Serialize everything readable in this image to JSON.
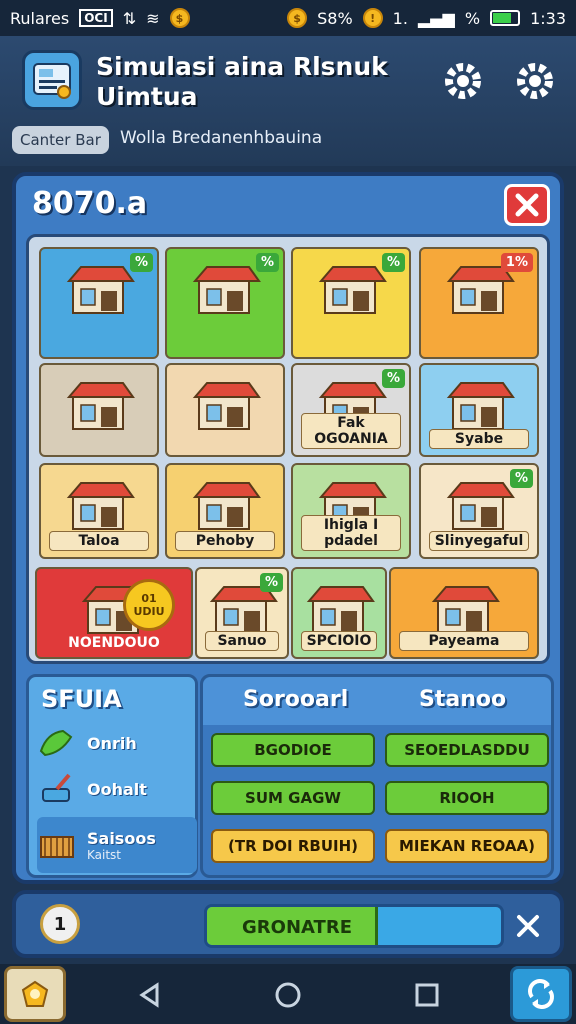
{
  "status_bar": {
    "carrier": "Rulares",
    "box_label": "OCI",
    "left_coin_glyph": "$",
    "percent_text": "S8%",
    "coin_glyph": "$",
    "signal_text": "1.",
    "signal_pct": "%",
    "time": "1:33",
    "battery_level": 0.7
  },
  "header": {
    "title_line1": "Simulasi aina Rlsnuk",
    "title_line2": "Uimtua",
    "chip_label": "Canter Bar",
    "subtitle": "Wolla Bredanenhbauina"
  },
  "panel": {
    "title": "8070.a",
    "tiles": [
      {
        "label": "",
        "badge": "%",
        "bg": "#4aa8e0",
        "icon": "shop-icon"
      },
      {
        "label": "",
        "badge": "%",
        "bg": "#6ccc3a",
        "icon": "store-icon"
      },
      {
        "label": "",
        "badge": "%",
        "bg": "#f6d84a",
        "icon": "kiosk-icon"
      },
      {
        "label": "",
        "badge": "1%",
        "bg": "#f6a83a",
        "icon": "market-stall-icon"
      },
      {
        "label": "",
        "badge": "",
        "bg": "#d8cdb8",
        "icon": "crates-icon"
      },
      {
        "label": "",
        "badge": "",
        "bg": "#f2d8b0",
        "icon": "storefront-icon"
      },
      {
        "label": "Fak OGOANIA",
        "badge": "%",
        "bg": "#dcdcdc",
        "icon": "machines-icon"
      },
      {
        "label": "Syabe",
        "badge": "",
        "bg": "#8ecff0",
        "icon": "warehouse-icon"
      },
      {
        "label": "Taloa",
        "badge": "",
        "bg": "#f6d890",
        "icon": "freezer-icon"
      },
      {
        "label": "Pehoby",
        "badge": "",
        "bg": "#f6d070",
        "icon": "register-icon"
      },
      {
        "label": "Ihigla I pdadel",
        "badge": "",
        "bg": "#b8e0a0",
        "icon": "cart-icon"
      },
      {
        "label": "Slinyegaful",
        "badge": "%",
        "bg": "#f6e6c8",
        "icon": "jars-icon"
      },
      {
        "label": "NOENDOUO",
        "badge": "",
        "bg": "#e03a3a",
        "icon": "basket-coin-icon",
        "coin_text": "01\nUDIU"
      },
      {
        "label": "Sanuo",
        "badge": "%",
        "bg": "#f6e6c0",
        "icon": "scanner-icon"
      },
      {
        "label": "SPCIOIO",
        "badge": "",
        "bg": "#a8e0a0",
        "icon": "magnifier-icon"
      },
      {
        "label": "Payeama",
        "badge": "",
        "bg": "#f6a83a",
        "icon": "cash-icon"
      }
    ]
  },
  "lower_left": {
    "title": "SFUIA",
    "items": [
      {
        "label": "Onrih",
        "icon": "scoop-icon"
      },
      {
        "label": "Oohalt",
        "icon": "knife-icon"
      },
      {
        "label": "Saisoos",
        "sublabel": "Kaitst",
        "icon": "basket-icon"
      }
    ]
  },
  "lower_right": {
    "col1": "Sorooarl",
    "col2": "Stanoo",
    "options": [
      {
        "label": "BGODIOE",
        "style": "green"
      },
      {
        "label": "SEOEDLASDDU",
        "style": "green"
      },
      {
        "label": "SUM GAGW",
        "style": "green"
      },
      {
        "label": "RIOOH",
        "style": "green"
      },
      {
        "label": "(TR DOI RBUIH)",
        "style": "yellow"
      },
      {
        "label": "MIEKAN REOAA)",
        "style": "yellow"
      }
    ]
  },
  "bottom_bar": {
    "coin_text": "1",
    "progress_label": "GRONATRE",
    "progress_value": 0.58
  },
  "colors": {
    "panel_blue": "#3e7cc4",
    "accent_green": "#6ccc3a",
    "accent_yellow": "#f6c84a",
    "close_red": "#e03a3a"
  }
}
